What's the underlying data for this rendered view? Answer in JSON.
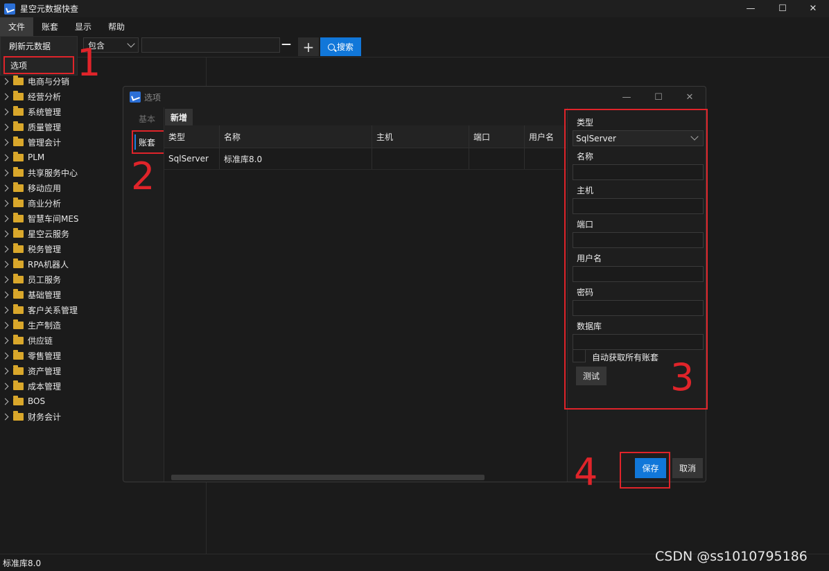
{
  "app": {
    "title": "星空元数据快查",
    "controls": {
      "minimize": "—",
      "maximize": "☐",
      "close": "✕"
    }
  },
  "menubar": {
    "items": [
      "文件",
      "账套",
      "显示",
      "帮助"
    ]
  },
  "file_menu": {
    "items": [
      "刷新元数据",
      "选项"
    ]
  },
  "toolbar": {
    "match_mode": "包含",
    "search_value": "",
    "minus": "—",
    "plus": "+",
    "search_label": "搜索"
  },
  "tree": {
    "items": [
      "电商与分销",
      "经营分析",
      "系统管理",
      "质量管理",
      "管理会计",
      "PLM",
      "共享服务中心",
      "移动应用",
      "商业分析",
      "智慧车间MES",
      "星空云服务",
      "税务管理",
      "RPA机器人",
      "员工服务",
      "基础管理",
      "客户关系管理",
      "生产制造",
      "供应链",
      "零售管理",
      "资产管理",
      "成本管理",
      "BOS",
      "财务会计"
    ]
  },
  "dialog": {
    "title": "选项",
    "nav": {
      "basic": "基本",
      "account": "账套"
    },
    "tab": "新增",
    "grid": {
      "columns": [
        "类型",
        "名称",
        "主机",
        "端口",
        "用户名"
      ],
      "rows": [
        [
          "SqlServer",
          "标准库8.0",
          "",
          "",
          ""
        ]
      ]
    },
    "form": {
      "type_label": "类型",
      "type_value": "SqlServer",
      "name_label": "名称",
      "name_value": "",
      "host_label": "主机",
      "host_value": "",
      "port_label": "端口",
      "port_value": "",
      "user_label": "用户名",
      "user_value": "",
      "password_label": "密码",
      "password_value": "",
      "database_label": "数据库",
      "database_value": "",
      "auto_fetch_label": "自动获取所有账套",
      "auto_fetch_checked": false,
      "test_label": "测试"
    },
    "save_label": "保存",
    "cancel_label": "取消"
  },
  "annotations": {
    "step1": "1",
    "step2": "2",
    "step3": "3",
    "step4": "4"
  },
  "statusbar": {
    "text": "标准库8.0"
  },
  "watermark": "CSDN @ss1010795186",
  "colors": {
    "accent": "#1177d9",
    "highlight": "#e0242a",
    "folder": "#d9a72b",
    "background": "#1b1b1b"
  }
}
